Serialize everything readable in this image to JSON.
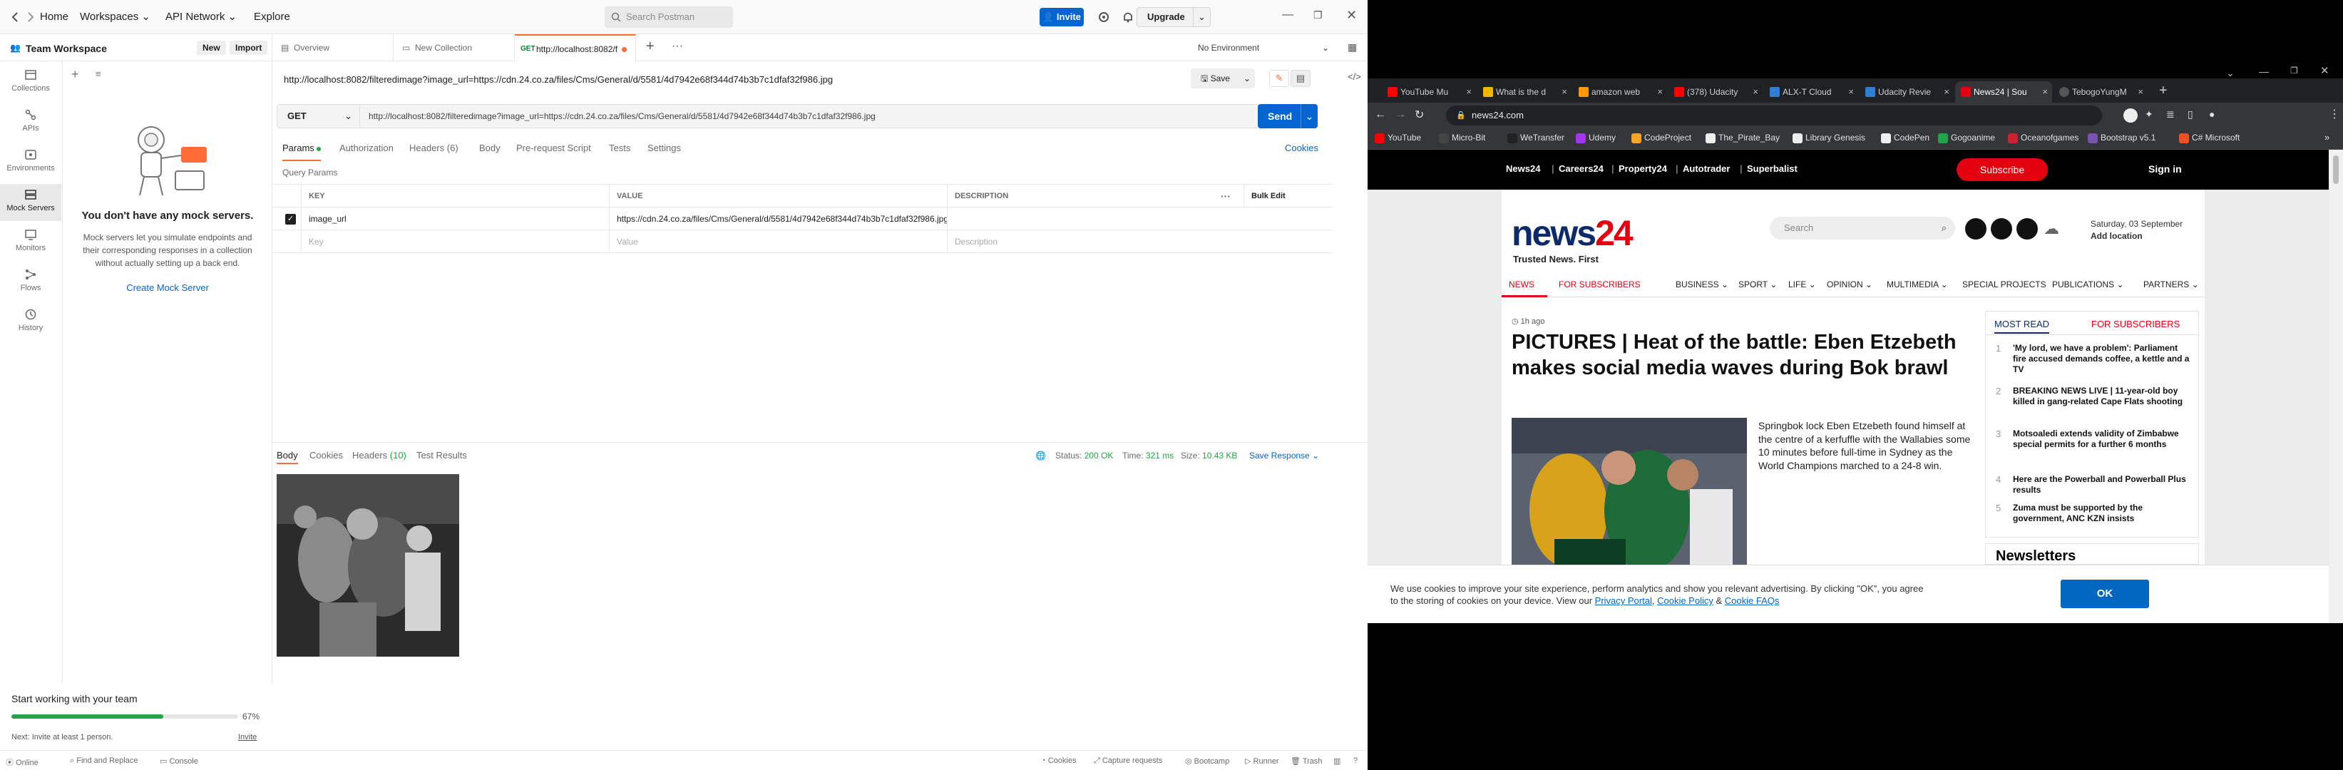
{
  "postman": {
    "nav": {
      "home": "Home",
      "workspaces": "Workspaces",
      "api_network": "API Network",
      "explore": "Explore"
    },
    "search_placeholder": "Search Postman",
    "invite": "Invite",
    "upgrade": "Upgrade",
    "workspace": {
      "name": "Team Workspace",
      "new": "New",
      "import": "Import"
    },
    "rail": [
      {
        "label": "Collections"
      },
      {
        "label": "APIs"
      },
      {
        "label": "Environments"
      },
      {
        "label": "Mock Servers"
      },
      {
        "label": "Monitors"
      },
      {
        "label": "Flows"
      },
      {
        "label": "History"
      }
    ],
    "mock_empty": {
      "title": "You don't have any mock servers.",
      "text": "Mock servers let you simulate endpoints and their corresponding responses in a collection without actually setting up a back end.",
      "cta": "Create Mock Server"
    },
    "tabs": {
      "overview": "Overview",
      "new_collection": "New Collection",
      "request_method": "GET",
      "request": "http://localhost:8082/f"
    },
    "environment": "No Environment",
    "url_title": "http://localhost:8082/filteredimage?image_url=https://cdn.24.co.za/files/Cms/General/d/5581/4d7942e68f344d74b3b7c1dfaf32f986.jpg",
    "save": "Save",
    "method": "GET",
    "url": "http://localhost:8082/filteredimage?image_url=https://cdn.24.co.za/files/Cms/General/d/5581/4d7942e68f344d74b3b7c1dfaf32f986.jpg",
    "send": "Send",
    "req_tabs": {
      "params": "Params",
      "authorization": "Authorization",
      "headers": "Headers",
      "headers_count": "(6)",
      "body": "Body",
      "prerequest": "Pre-request Script",
      "tests": "Tests",
      "settings": "Settings",
      "cookies": "Cookies"
    },
    "query_params": "Query Params",
    "table": {
      "headers": {
        "key": "KEY",
        "value": "VALUE",
        "description": "DESCRIPTION",
        "bulk": "Bulk Edit"
      },
      "row": {
        "key": "image_url",
        "value": "https://cdn.24.co.za/files/Cms/General/d/5581/4d7942e68f344d74b3b7c1dfaf32f986.jpg"
      },
      "placeholder": {
        "key": "Key",
        "value": "Value",
        "description": "Description"
      }
    },
    "response": {
      "tabs": {
        "body": "Body",
        "cookies": "Cookies",
        "headers": "Headers",
        "headers_count": "(10)",
        "test_results": "Test Results"
      },
      "status_label": "Status:",
      "status": "200 OK",
      "time_label": "Time:",
      "time": "321 ms",
      "size_label": "Size:",
      "size": "10.43 KB",
      "save_response": "Save Response"
    },
    "onboard": {
      "title": "Start working with your team",
      "percent": "67%",
      "progress": 0.67,
      "next": "Next: Invite at least 1 person.",
      "invite": "Invite"
    },
    "statusbar": {
      "online": "Online",
      "find": "Find and Replace",
      "console": "Console",
      "cookies": "Cookies",
      "capture": "Capture requests",
      "bootcamp": "Bootcamp",
      "runner": "Runner",
      "trash": "Trash"
    }
  },
  "browser": {
    "tabs": [
      {
        "title": "YouTube Mu",
        "color": "#ff0000"
      },
      {
        "title": "What is the d",
        "color": "#f2b600"
      },
      {
        "title": "amazon web",
        "color": "#ff9900"
      },
      {
        "title": "(378) Udacity",
        "color": "#ff0000"
      },
      {
        "title": "ALX-T Cloud",
        "color": "#2f7fd6"
      },
      {
        "title": "Udacity Revie",
        "color": "#2f7fd6"
      },
      {
        "title": "News24 | Sou",
        "color": "#e3000f"
      },
      {
        "title": "TebogoYungM",
        "color": "#555555"
      }
    ],
    "url": "news24.com",
    "bookmarks": [
      {
        "label": "YouTube",
        "color": "#ff0000"
      },
      {
        "label": "Micro-Bit",
        "color": "#444444"
      },
      {
        "label": "WeTransfer",
        "color": "#222222"
      },
      {
        "label": "Udemy",
        "color": "#a435f0"
      },
      {
        "label": "CodeProject",
        "color": "#f5a623"
      },
      {
        "label": "The_Pirate_Bay",
        "color": "#eeeeee"
      },
      {
        "label": "Library Genesis",
        "color": "#eeeeee"
      },
      {
        "label": "CodePen",
        "color": "#eeeeee"
      },
      {
        "label": "Gogoanime",
        "color": "#1fa64b"
      },
      {
        "label": "Oceanofgames",
        "color": "#d1202f"
      },
      {
        "label": "Bootstrap v5.1",
        "color": "#7952b3"
      },
      {
        "label": "C# Microsoft",
        "color": "#f25022"
      }
    ],
    "news24": {
      "top_links": [
        "News24",
        "Careers24",
        "Property24",
        "Autotrader",
        "Superbalist"
      ],
      "subscribe": "Subscribe",
      "signin": "Sign in",
      "logo_a": "news",
      "logo_b": "24",
      "tagline": "Trusted News. First",
      "search": "Search",
      "date": "Saturday, 03 September",
      "location": "Add location",
      "nav": [
        "NEWS",
        "FOR SUBSCRIBERS",
        "BUSINESS",
        "SPORT",
        "LIFE",
        "OPINION",
        "MULTIMEDIA",
        "SPECIAL PROJECTS",
        "PUBLICATIONS",
        "PARTNERS"
      ],
      "time": "1h ago",
      "headline": "PICTURES | Heat of the battle: Eben Etzebeth makes social media waves during Bok brawl",
      "lede": "Springbok lock Eben Etzebeth found himself at the centre of a kerfuffle with the Wallabies some 10 minutes before full-time in Sydney as the World Champions marched to a 24-8 win.",
      "most_read": "MOST READ",
      "for_subscribers": "FOR SUBSCRIBERS",
      "most_read_items": [
        {
          "num": "1",
          "text": "'My lord, we have a problem': Parliament fire accused demands coffee, a kettle and a TV"
        },
        {
          "num": "2",
          "text": "BREAKING NEWS LIVE | 11-year-old boy killed in gang-related Cape Flats shooting"
        },
        {
          "num": "3",
          "text": "Motsoaledi extends validity of Zimbabwe special permits for a further 6 months"
        },
        {
          "num": "4",
          "text": "Here are the Powerball and Powerball Plus results"
        },
        {
          "num": "5",
          "text": "Zuma must be supported by the government, ANC KZN insists"
        }
      ],
      "newsletters": "Newsletters",
      "cookie_text_a": "We use cookies to improve your site experience, perform analytics and show you relevant advertising. By clicking \"OK\", you agree to the storing of cookies on your device. View our ",
      "privacy": "Privacy Portal",
      "cookie_policy": "Cookie Policy",
      "amp": " & ",
      "cookie_faqs": "Cookie FAQs",
      "ok": "OK"
    }
  }
}
